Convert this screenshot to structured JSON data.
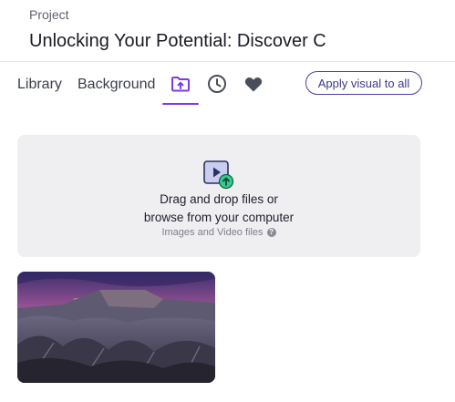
{
  "header": {
    "label": "Project",
    "title": "Unlocking Your Potential: Discover C"
  },
  "tabs": {
    "library": "Library",
    "background": "Background",
    "upload_icon": "folder-upload-icon",
    "recent_icon": "clock-icon",
    "favorites_icon": "heart-icon"
  },
  "apply_button": "Apply visual to all",
  "dropzone": {
    "line1": "Drag and drop files or",
    "line2": "browse from your computer",
    "hint": "Images and Video files",
    "help_icon": "?"
  },
  "colors": {
    "accent": "#7c3aed",
    "button_border": "#4b3fa8",
    "dropzone_bg": "#efeff1",
    "upload_badge": "#2ecc8f"
  }
}
